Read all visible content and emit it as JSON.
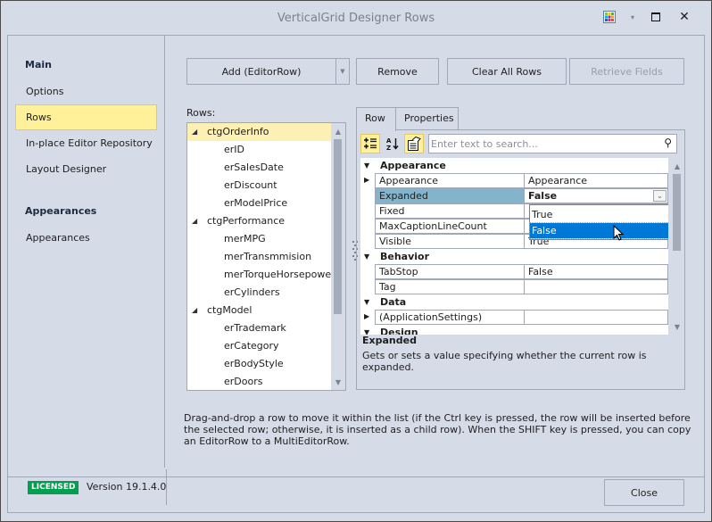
{
  "window": {
    "title": "VerticalGrid Designer Rows",
    "controls": {
      "skin_icon": "skin-palette-icon",
      "skin_dropdown": "▾",
      "maximize": "□",
      "close": "✕"
    }
  },
  "nav": {
    "groups": [
      {
        "label": "Main",
        "items": [
          "Options",
          "Rows",
          "In-place Editor Repository",
          "Layout Designer"
        ]
      },
      {
        "label": "Appearances",
        "items": [
          "Appearances"
        ]
      }
    ],
    "selected": "Rows"
  },
  "toolbar": {
    "add_label": "Add (EditorRow)",
    "remove_label": "Remove",
    "clear_label": "Clear All Rows",
    "retrieve_label": "Retrieve Fields"
  },
  "rows_panel": {
    "label": "Rows:",
    "tree": [
      {
        "text": "ctgOrderInfo",
        "level": 0,
        "expanded": true,
        "selected": true
      },
      {
        "text": "erID",
        "level": 1
      },
      {
        "text": "erSalesDate",
        "level": 1
      },
      {
        "text": "erDiscount",
        "level": 1
      },
      {
        "text": "erModelPrice",
        "level": 1
      },
      {
        "text": "ctgPerformance",
        "level": 0,
        "expanded": true
      },
      {
        "text": "merMPG",
        "level": 1
      },
      {
        "text": "merTransmmision",
        "level": 1
      },
      {
        "text": "merTorqueHorsepower",
        "level": 1
      },
      {
        "text": "erCylinders",
        "level": 1
      },
      {
        "text": "ctgModel",
        "level": 0,
        "expanded": true
      },
      {
        "text": "erTrademark",
        "level": 1
      },
      {
        "text": "erCategory",
        "level": 1
      },
      {
        "text": "erBodyStyle",
        "level": 1
      },
      {
        "text": "erDoors",
        "level": 1
      }
    ]
  },
  "tabs": [
    {
      "label": "Row",
      "active": true
    },
    {
      "label": "Properties",
      "active": false
    }
  ],
  "property_grid": {
    "search_placeholder": "Enter text to search...",
    "tools": [
      "categorized-icon",
      "alphabetical-icon",
      "property-pages-icon"
    ],
    "categories": [
      {
        "name": "Appearance",
        "rows": [
          {
            "name": "Appearance",
            "value": "Appearance",
            "expandable": true
          },
          {
            "name": "Expanded",
            "value": "False",
            "focused": true
          },
          {
            "name": "Fixed",
            "value": ""
          },
          {
            "name": "MaxCaptionLineCount",
            "value": ""
          },
          {
            "name": "Visible",
            "value": "True"
          }
        ]
      },
      {
        "name": "Behavior",
        "rows": [
          {
            "name": "TabStop",
            "value": "False"
          },
          {
            "name": "Tag",
            "value": ""
          }
        ]
      },
      {
        "name": "Data",
        "rows": [
          {
            "name": "(ApplicationSettings)",
            "value": "",
            "expandable": true
          }
        ]
      },
      {
        "name": "Design",
        "rows": []
      }
    ],
    "dropdown": {
      "options": [
        "True",
        "False"
      ],
      "selected": "False"
    },
    "description": {
      "title": "Expanded",
      "text": "Gets or sets a value specifying whether the current row is expanded."
    }
  },
  "hint": "Drag-and-drop a row to move it within the list (if the Ctrl key is pressed, the row will be inserted before the selected row; otherwise, it is inserted as a child row). When the SHIFT key is pressed, you can copy an EditorRow to a MultiEditorRow.",
  "footer": {
    "license_badge": "LICENSED",
    "version": "Version 19.1.4.0",
    "close_label": "Close"
  },
  "colors": {
    "selection_yellow": "#fff09a",
    "focused_row": "#84b4cc",
    "dropdown_selected": "#0078d7",
    "licensed_green": "#00a050"
  }
}
